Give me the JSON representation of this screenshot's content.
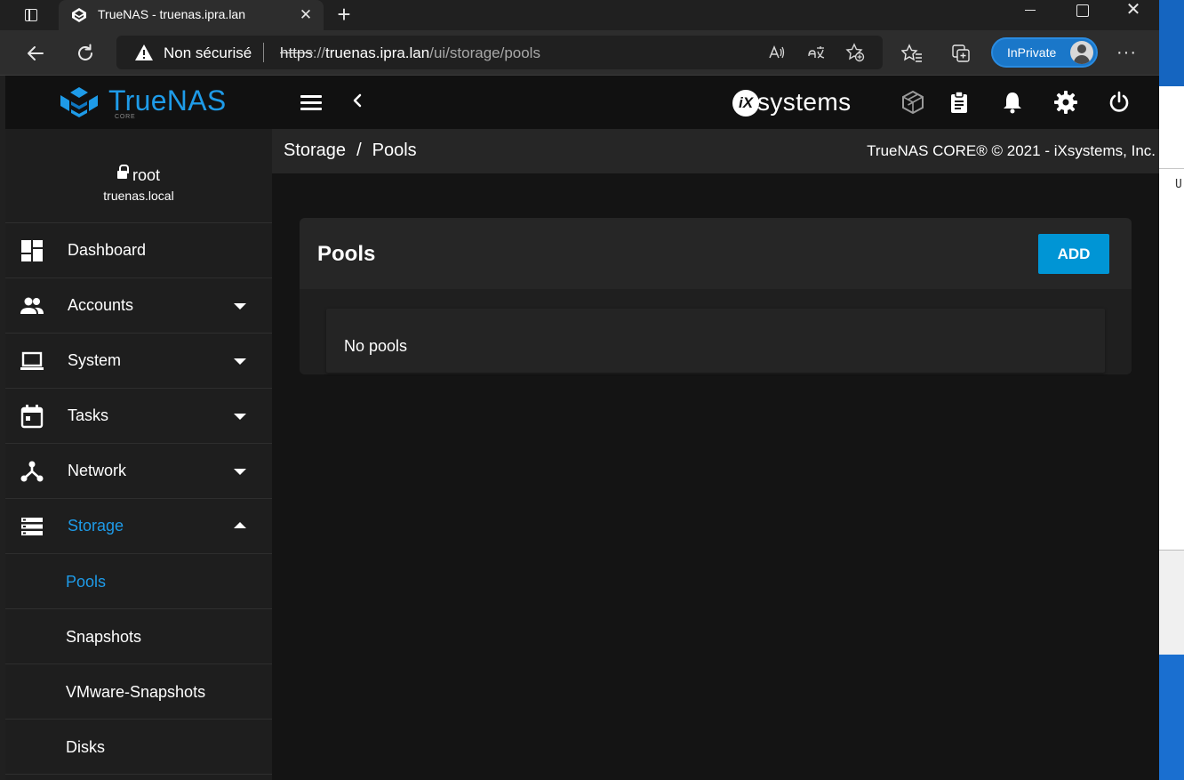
{
  "browser": {
    "tab_title": "TrueNAS - truenas.ipra.lan",
    "tab_close": "✕",
    "new_tab": "+",
    "security_label": "Non sécurisé",
    "url": {
      "scheme": "https",
      "separator": "://",
      "host": "truenas.ipra.lan",
      "path": "/ui/storage/pools"
    },
    "inprivate_label": "InPrivate",
    "more": "···",
    "window_close": "✕"
  },
  "desktop": {
    "strip_text": "U"
  },
  "app": {
    "logo_text": "TrueNAS",
    "logo_sub": "CORE",
    "vendor_logo": {
      "mark": "iX",
      "text": "systems"
    },
    "accent_color": "#1e9be8",
    "breadcrumb": {
      "parent": "Storage",
      "separator": "/",
      "current": "Pools"
    },
    "copyright": "TrueNAS CORE® © 2021 - iXsystems, Inc.",
    "user": {
      "name": "root",
      "host": "truenas.local"
    },
    "sidebar": {
      "items": [
        {
          "label": "Dashboard",
          "icon": "dashboard-icon",
          "expandable": false
        },
        {
          "label": "Accounts",
          "icon": "people-icon",
          "expandable": true
        },
        {
          "label": "System",
          "icon": "laptop-icon",
          "expandable": true
        },
        {
          "label": "Tasks",
          "icon": "calendar-icon",
          "expandable": true
        },
        {
          "label": "Network",
          "icon": "network-icon",
          "expandable": true
        },
        {
          "label": "Storage",
          "icon": "storage-icon",
          "expandable": true,
          "expanded": true,
          "active": true
        }
      ],
      "storage_children": [
        {
          "label": "Pools",
          "active": true
        },
        {
          "label": "Snapshots"
        },
        {
          "label": "VMware-Snapshots"
        },
        {
          "label": "Disks"
        }
      ]
    },
    "pools_card": {
      "title": "Pools",
      "add_label": "ADD",
      "empty_text": "No pools"
    }
  }
}
